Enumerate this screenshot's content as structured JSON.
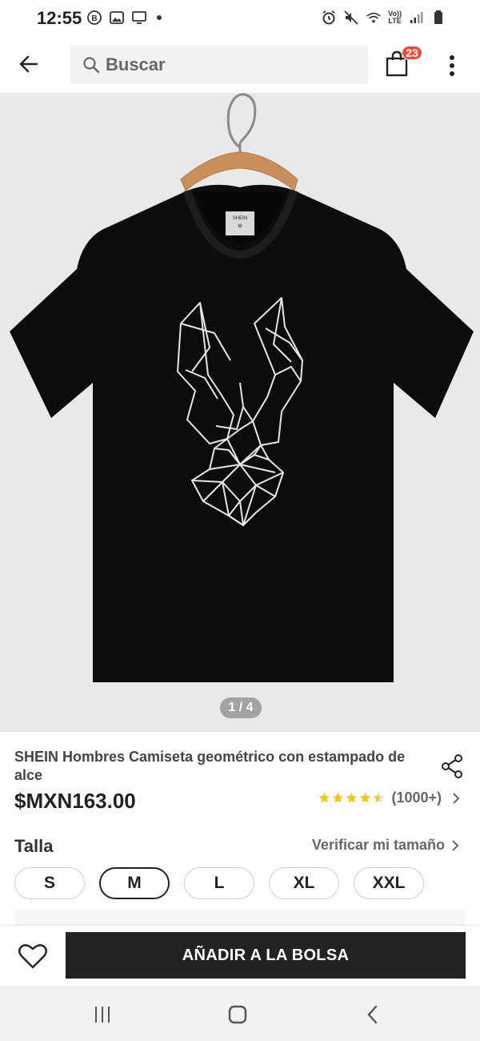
{
  "status_bar": {
    "time": "12:55",
    "left_icons": [
      "b-icon",
      "gallery-icon",
      "cast-icon",
      "dot-icon"
    ],
    "right_icons": [
      "alarm-icon",
      "mute-icon",
      "wifi-icon",
      "volte-icon",
      "signal-icon",
      "battery-icon"
    ],
    "volte_text": "Vo)) LTE"
  },
  "app_bar": {
    "search_placeholder": "Buscar",
    "cart_count": "23",
    "accent_color": "#f0493a"
  },
  "product_image": {
    "counter": "1 / 4",
    "description_icons": [
      "tshirt-icon",
      "hanger-icon",
      "deer-print-icon"
    ]
  },
  "product": {
    "title": "SHEIN Hombres Camiseta geométrico con estampado de alce",
    "price": "$MXN163.00",
    "rating_stars": 4.5,
    "rating_count": "(1000+)",
    "star_color": "#f5c518"
  },
  "size": {
    "label": "Talla",
    "guide": "Verificar mi tamaño",
    "options": [
      "S",
      "M",
      "L",
      "XL",
      "XXL"
    ],
    "selected": "M"
  },
  "action_bar": {
    "add_to_bag": "AÑADIR A LA BOLSA"
  }
}
